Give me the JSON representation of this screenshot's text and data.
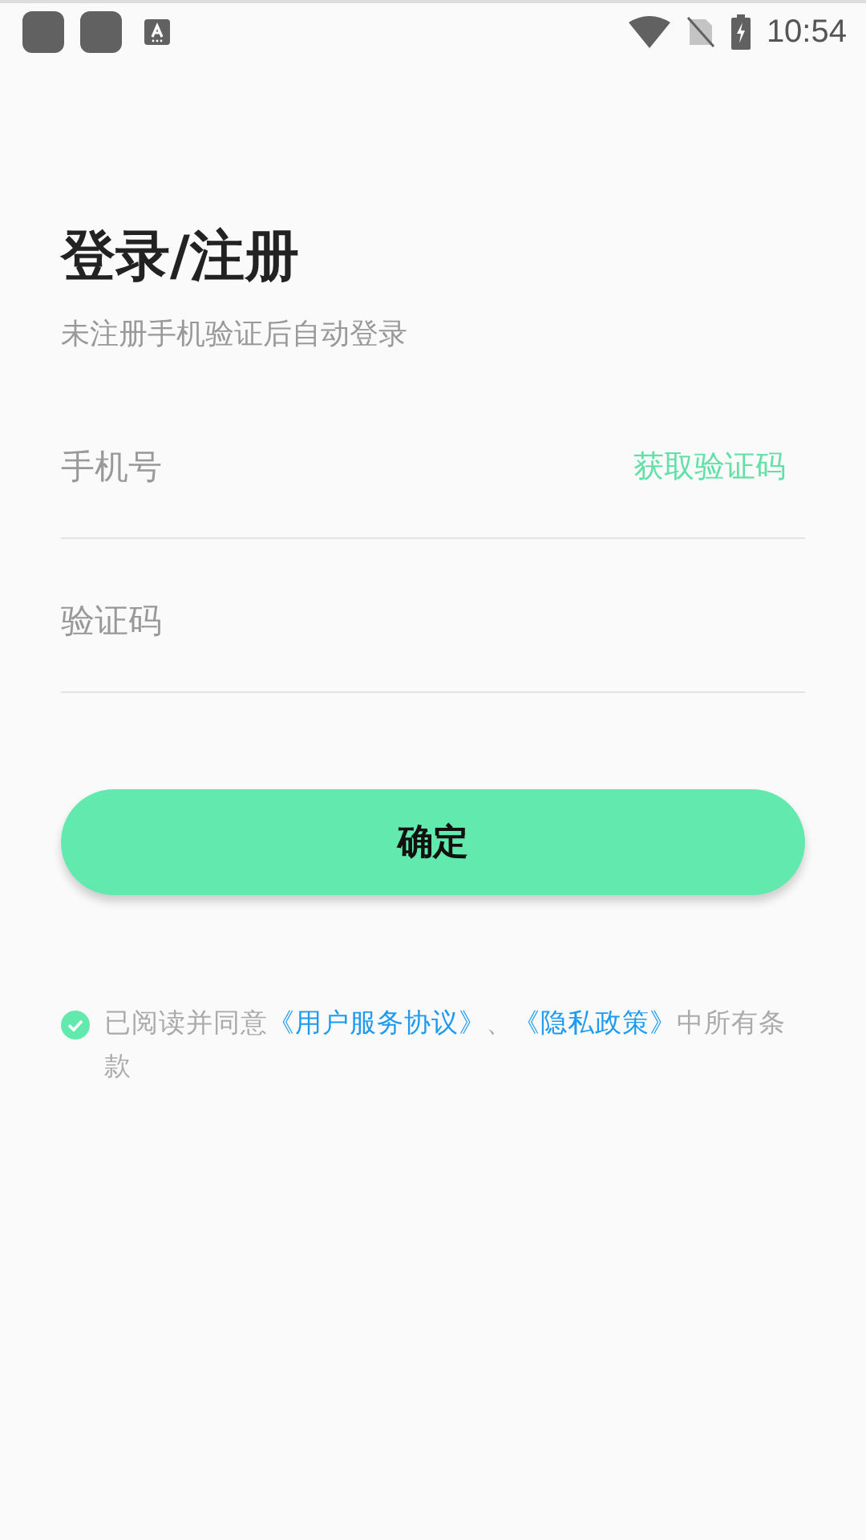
{
  "status_bar": {
    "time": "10:54"
  },
  "title": "登录/注册",
  "subtitle": "未注册手机验证后自动登录",
  "phone_field": {
    "placeholder": "手机号"
  },
  "get_code_link": "获取验证码",
  "code_field": {
    "placeholder": "验证码"
  },
  "confirm_button": "确定",
  "agreement": {
    "checked": true,
    "segments": [
      {
        "kind": "text",
        "text": "已阅读并同意"
      },
      {
        "kind": "link",
        "text": "《用户服务协议》"
      },
      {
        "kind": "text",
        "text": "、"
      },
      {
        "kind": "link",
        "text": "《隐私政策》"
      },
      {
        "kind": "text",
        "text": "中所有条款"
      }
    ]
  }
}
